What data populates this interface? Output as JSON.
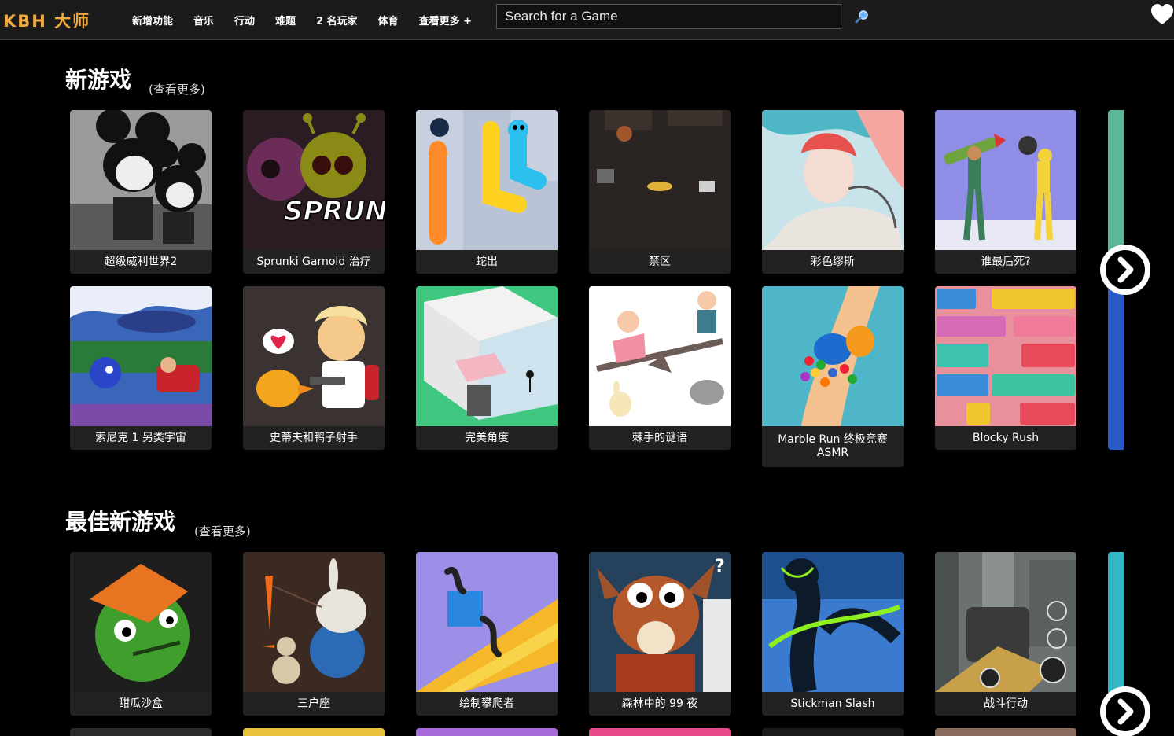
{
  "header": {
    "logo": "KBH 大师",
    "nav": [
      "新增功能",
      "音乐",
      "行动",
      "难题",
      "2 名玩家",
      "体育",
      "查看更多 +"
    ],
    "search_placeholder": "Search for a Game"
  },
  "sections": [
    {
      "title": "新游戏",
      "see_more": "(查看更多)",
      "rows": [
        [
          "超级威利世界2",
          "Sprunki Garnold 治疗",
          "蛇出",
          "禁区",
          "彩色缪斯",
          "谁最后死?"
        ],
        [
          "索尼克 1 另类宇宙",
          "史蒂夫和鸭子射手",
          "完美角度",
          "棘手的谜语",
          "Marble Run 终极竞赛 ASMR",
          "Blocky Rush"
        ]
      ]
    },
    {
      "title": "最佳新游戏",
      "see_more": "(查看更多)",
      "rows": [
        [
          "甜瓜沙盒",
          "三户座",
          "绘制攀爬者",
          "森林中的 99 夜",
          "Stickman Slash",
          "战斗行动"
        ]
      ]
    }
  ],
  "colors": {
    "accent": "#f2a93b",
    "header_bg": "#1b1b1b",
    "card_bg": "#222222"
  }
}
